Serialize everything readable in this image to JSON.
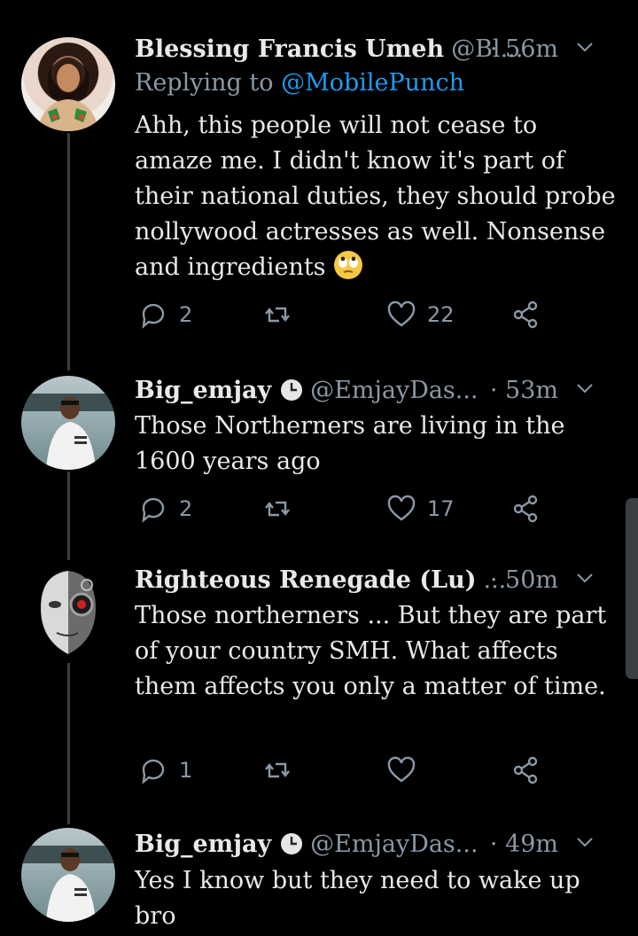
{
  "tweets": [
    {
      "name": "Blessing Francis Umeh",
      "handle": "@Bl...",
      "time": "· 56m",
      "replying_label": "Replying to",
      "replying_mention": "@MobilePunch",
      "text": "Ahh, this people will not cease to amaze me. I didn't know it's part of their national duties, they should probe nollywood actresses as well. Nonsense and ingredients",
      "emoji": "face-with-rolling-eyes",
      "replies": "2",
      "retweets": "",
      "likes": "22"
    },
    {
      "name": "Big_emjay",
      "handle": "@EmjayDas...",
      "time": "· 53m",
      "text": "Those Northerners are living in the 1600 years ago",
      "replies": "2",
      "retweets": "",
      "likes": "17"
    },
    {
      "name": "Righteous Renegade (Lu)",
      "handle": "...",
      "time": "· 50m",
      "text": "Those northerners ... But they are part of your country SMH. What affects them affects you only a matter of time.",
      "replies": "1",
      "retweets": "",
      "likes": ""
    },
    {
      "name": "Big_emjay",
      "handle": "@EmjayDas...",
      "time": "· 49m",
      "text": "Yes I know but they need to wake up bro"
    }
  ],
  "icons": {
    "reply": "speech-bubble-icon",
    "retweet": "retweet-icon",
    "like": "heart-icon",
    "share": "share-icon",
    "more": "chevron-down-icon",
    "clock": "clock-icon"
  },
  "colors": {
    "background": "#000000",
    "text": "#e7e9ea",
    "muted": "#8b98a5",
    "link": "#1d9bf0",
    "thread": "#3a3f44"
  }
}
